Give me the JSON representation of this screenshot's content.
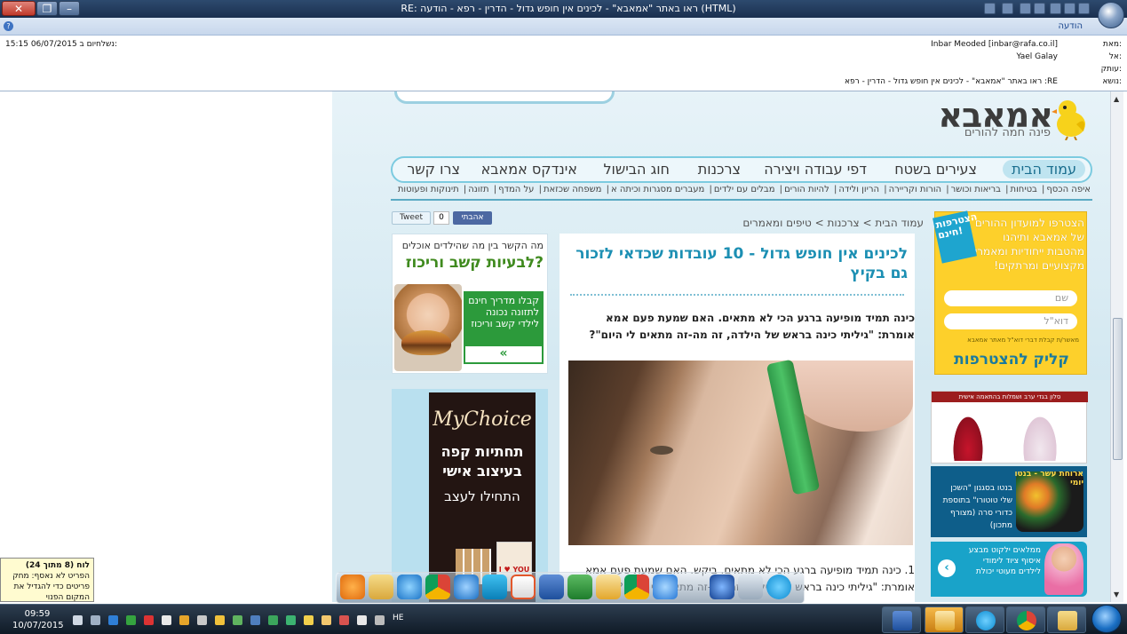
{
  "window": {
    "title": "RE: ראו באתר \"אמאבא\" - לכינים אין חופש גדול - הדרין - רפא - הודעה (HTML)",
    "ribbon_tab": "הודעה"
  },
  "header": {
    "from_label": "מאת:",
    "from_value": "Inbar Meoded [inbar@rafa.co.il]",
    "to_label": "אל:",
    "to_value": "Yael Galay",
    "cc_label": "עותק:",
    "cc_value": "",
    "subject_label": "נושא:",
    "subject_value": "RE: ראו באתר \"אמאבא\" - לכינים אין חופש גדול - הדרין - רפא",
    "sent_label": "נשלח:",
    "sent_value": "יום ב 06/07/2015 15:15"
  },
  "site": {
    "logo": "אמאבא",
    "tagline": "פינה חמה להורים",
    "nav": [
      {
        "label": "עמוד הבית"
      },
      {
        "label": "צעירים בשטח"
      },
      {
        "label": "דפי עבודה ויצירה"
      },
      {
        "label": "צרכנות"
      },
      {
        "label": "חוג הבישול"
      },
      {
        "label": "אינדקס אמאבא"
      },
      {
        "label": "צרו קשר"
      }
    ],
    "subnav": [
      "איפה הכסף",
      "בטיחות",
      "בריאות וכושר",
      "הורות וקריירה",
      "הריון ולידה",
      "להיות הורים",
      "מבלים עם ילדים",
      "מעברים מסגרות וכיתה א",
      "משפחה שכזאת",
      "על המדף",
      "תזונה",
      "תינוקות ופעוטות"
    ],
    "fb_like": "אהבתי",
    "like_count": "0",
    "tweet": "Tweet",
    "breadcrumb": "עמוד הבית > צרכנות > טיפים ומאמרים"
  },
  "article": {
    "title": "לכינים אין חופש גדול - 10 עובדות שכדאי לזכור גם בקיץ",
    "intro": "כינה תמיד מופיעה ברגע הכי לא מתאים. האם שמעת פעם אמא אומרת: \"גיליתי כינה בראש של הילדה, זה מה-זה מתאים לי היום\"?",
    "point1": "1. כינה תמיד מופיעה ברגע הכי לא מתאים. ביקש. האם שמעת פעם אמא אומרת: \"גיליתי כינה בראש של הילדה, זה מה-זה מתאים לי היום\"?"
  },
  "ads": {
    "burger_q": "מה הקשר בין מה שהילדים אוכלים",
    "burger_head": "לבעיות קשב וריכוז?",
    "burger_cta": "קבלו מדריך חינם לתזונה נכונה לילדי קשב וריכוז",
    "burger_arrow": "«",
    "join_badge": "הצטרפות חינם!",
    "join_text": "הצטרפו למועדון ההורים של אמאבא ותיהנו מהטבות ייחודיות ומאמרים מקצועיים ומרתקים!",
    "join_name_placeholder": "שם",
    "join_email_placeholder": "דוא\"ל",
    "join_consent": "מאשר/ת קבלת דברי דוא\"ל מאתר אמאבא",
    "join_button": "קליק להצטרפות",
    "dresses_banner": "סלון בגדי ערב ושמלות בהתאמה אישית",
    "lunch_head": "ארוחת עשר - בנטו יומי",
    "lunch_body": "בנטו בסגנון \"השכן שלי טוטורו\" בתוספת כדורי סרה (מצורף מתכון)",
    "toys_text": "ממלאים ילקוט מבצע איסוף ציוד לימודי לילדים מעוטי יכולת",
    "toys_arrow": "‹",
    "coffee_brand": "MyChoice",
    "coffee_l1": "תחתיות קפה בעיצוב אישי",
    "coffee_l2": "התחילו לעצב",
    "coffee_card": "I ♥ YOU"
  },
  "taskbar": {
    "time": "09:59",
    "date": "10/07/2015",
    "lang": "HE"
  },
  "toast": {
    "title": "לוח (8 מתוך 24)",
    "body": "הפריט לא נאסף: מחק פריטים כדי להגדיל את המקום הפנוי"
  },
  "colors": {
    "title_bar": "#1a2f4f",
    "ribbon": "#c7d7ec",
    "site_accent": "#1c8fb3",
    "join_yellow": "#fdd02b",
    "taskbar": "#0f1a26"
  }
}
